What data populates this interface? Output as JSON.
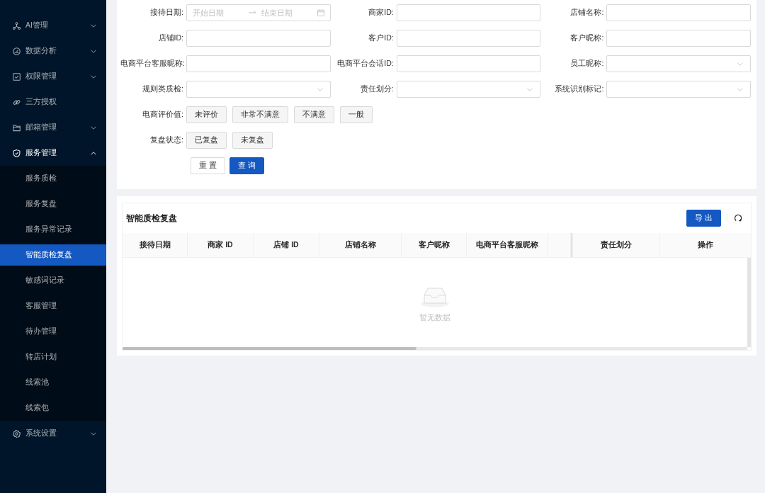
{
  "sidebar": {
    "items": [
      {
        "label": "AI管理",
        "kind": "group",
        "expanded": false
      },
      {
        "label": "数据分析",
        "kind": "group",
        "expanded": false
      },
      {
        "label": "权限管理",
        "kind": "group",
        "expanded": false
      },
      {
        "label": "三方授权",
        "kind": "link",
        "selected": false
      },
      {
        "label": "邮箱管理",
        "kind": "group",
        "expanded": false
      },
      {
        "label": "服务管理",
        "kind": "group",
        "expanded": true,
        "children": [
          {
            "label": "服务质检",
            "selected": false
          },
          {
            "label": "服务复盘",
            "selected": false
          },
          {
            "label": "服务异常记录",
            "selected": false
          },
          {
            "label": "智能质检复盘",
            "selected": true
          },
          {
            "label": "敏感词记录",
            "selected": false
          },
          {
            "label": "客服管理",
            "selected": false
          },
          {
            "label": "待办管理",
            "selected": false
          },
          {
            "label": "转店计划",
            "selected": false
          },
          {
            "label": "线索池",
            "selected": false
          },
          {
            "label": "线索包",
            "selected": false
          }
        ]
      },
      {
        "label": "系统设置",
        "kind": "group",
        "expanded": false
      }
    ]
  },
  "filters": {
    "fields": [
      {
        "label": "接待日期:",
        "kind": "date_range",
        "start_placeholder": "开始日期",
        "end_placeholder": "结束日期"
      },
      {
        "label": "商家ID:",
        "kind": "text"
      },
      {
        "label": "店铺名称:",
        "kind": "text"
      },
      {
        "label": "店铺ID:",
        "kind": "text"
      },
      {
        "label": "客户ID:",
        "kind": "text"
      },
      {
        "label": "客户昵称:",
        "kind": "text"
      },
      {
        "label": "电商平台客服昵称:",
        "kind": "text"
      },
      {
        "label": "电商平台会话ID:",
        "kind": "text"
      },
      {
        "label": "员工昵称:",
        "kind": "select"
      },
      {
        "label": "规则类质检:",
        "kind": "select"
      },
      {
        "label": "责任划分:",
        "kind": "select"
      },
      {
        "label": "系统识别标记:",
        "kind": "select"
      }
    ],
    "option_groups": [
      {
        "label": "电商评价值:",
        "options": [
          {
            "label": "未评价",
            "selected": false
          },
          {
            "label": "非常不满意",
            "selected": false
          },
          {
            "label": "不满意",
            "selected": false
          },
          {
            "label": "一般",
            "selected": false
          }
        ]
      },
      {
        "label": "复盘状态:",
        "options": [
          {
            "label": "已复盘",
            "selected": false
          },
          {
            "label": "未复盘",
            "selected": false
          }
        ]
      }
    ],
    "buttons": [
      {
        "label": "重 置",
        "kind": "default"
      },
      {
        "label": "查 询",
        "kind": "primary"
      }
    ]
  },
  "table": {
    "title": "智能质检复盘",
    "export_button": "导 出",
    "columns": [
      "接待日期",
      "商家 ID",
      "店铺 ID",
      "店铺名称",
      "客户昵称",
      "电商平台客服昵称"
    ],
    "fixed_columns": [
      "责任划分",
      "操作"
    ],
    "empty_text": "暂无数据"
  }
}
